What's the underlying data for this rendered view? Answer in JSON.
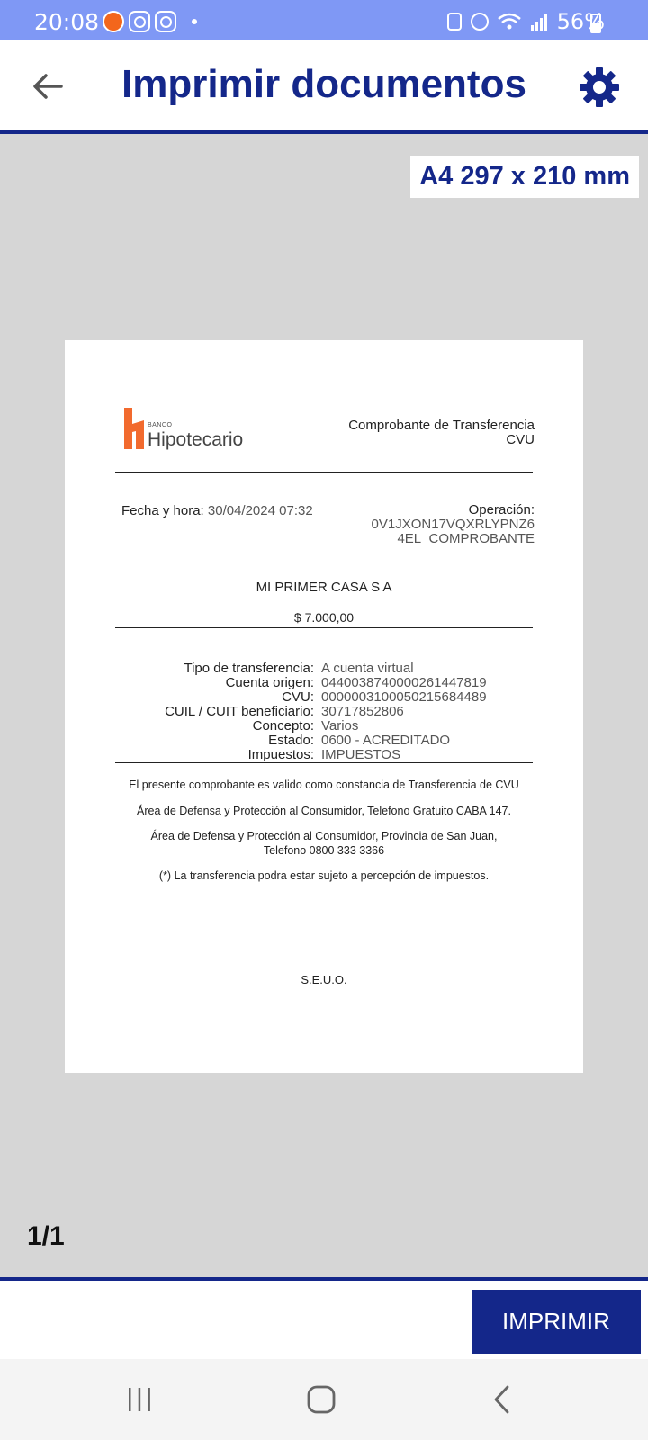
{
  "status_bar": {
    "time": "20:08",
    "battery": "56%"
  },
  "app_bar": {
    "title": "Imprimir documentos",
    "back_icon": "arrow-back-icon",
    "settings_icon": "gear-icon",
    "accent_color": "#14278a"
  },
  "preview": {
    "paper_size": "A4 297 x 210 mm",
    "page_counter": "1/1"
  },
  "document": {
    "logo": {
      "prefix": "BANCO",
      "name": "Hipotecario"
    },
    "heading_line1": "Comprobante de Transferencia",
    "heading_line2": "CVU",
    "fecha_label": "Fecha y hora:",
    "fecha_value": "30/04/2024 07:32",
    "operacion_label": "Operación:",
    "operacion_line1": "0V1JXON17VQXRLYPNZ6",
    "operacion_line2": "4EL_COMPROBANTE",
    "beneficiary": "MI PRIMER CASA S A",
    "amount": "$ 7.000,00",
    "details": [
      {
        "label": "Tipo de transferencia:",
        "value": "A cuenta virtual"
      },
      {
        "label": "Cuenta origen:",
        "value": "0440038740000261447819"
      },
      {
        "label": "CVU:",
        "value": "0000003100050215684489"
      },
      {
        "label": "CUIL / CUIT beneficiario:",
        "value": "30717852806"
      },
      {
        "label": "Concepto:",
        "value": "Varios"
      },
      {
        "label": "Estado:",
        "value": "0600 - ACREDITADO"
      },
      {
        "label": "Impuestos:",
        "value": "IMPUESTOS"
      }
    ],
    "notes": {
      "valid": "El presente comprobante es valido como constancia de Transferencia de CVU",
      "caba": "Área de Defensa y Protección al Consumidor, Telefono Gratuito CABA 147.",
      "san_juan_line1": "Área de Defensa y Protección al Consumidor, Provincia de San Juan,",
      "san_juan_line2": "Telefono 0800 333 3366",
      "taxes": "(*) La transferencia podra estar sujeto a percepción de impuestos."
    },
    "seuo": "S.E.U.O."
  },
  "actions": {
    "print_label": "IMPRIMIR"
  },
  "nav": {
    "recents_icon": "recents-icon",
    "home_icon": "home-icon",
    "back_icon": "nav-back-icon"
  }
}
